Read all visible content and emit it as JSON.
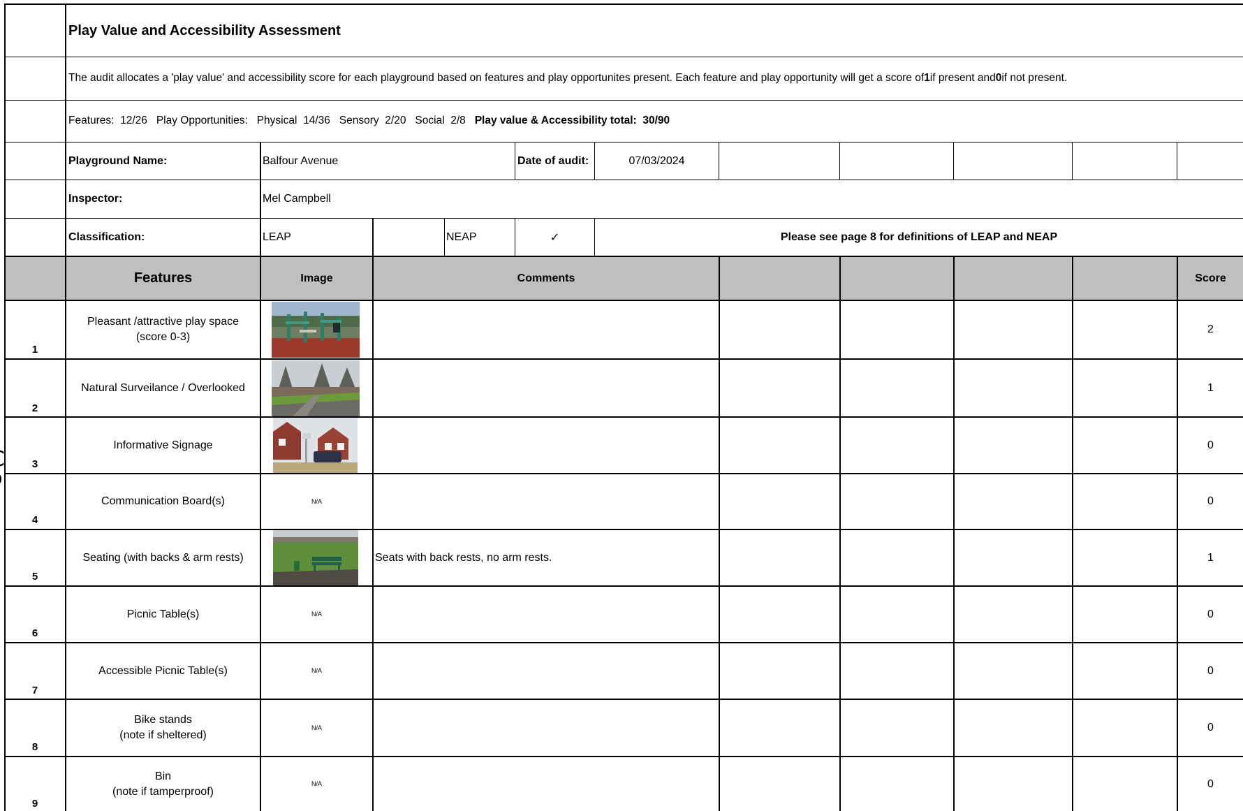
{
  "title": "Play Value and Accessibility Assessment",
  "intro": {
    "before": "The audit  allocates a 'play value' and accessibility score for each playground based on features and play opportunites present.  Each feature and play opportunity will get a score of ",
    "one": "1",
    "middle": " if present and ",
    "zero": "0",
    "after": " if not present."
  },
  "summary": {
    "features_label": "Features:",
    "features_value": "12/26",
    "opportunities_label": "Play Opportunities:",
    "physical_label": "Physical",
    "physical_value": "14/36",
    "sensory_label": "Sensory",
    "sensory_value": "2/20",
    "social_label": "Social",
    "social_value": "2/8",
    "total_label": "Play value & Accessibility total:",
    "total_value": "30/90"
  },
  "info": {
    "playground_label": "Playground Name:",
    "playground_value": "Balfour Avenue",
    "date_label": "Date of audit:",
    "date_value": "07/03/2024",
    "inspector_label": "Inspector:",
    "inspector_value": "Mel Campbell",
    "classification_label": "Classification:",
    "leap_label": "LEAP",
    "neap_label": "NEAP",
    "neap_check": "✓",
    "definitions_note": "Please see page 8 for definitions of LEAP and NEAP"
  },
  "table": {
    "headers": {
      "features": "Features",
      "image": "Image",
      "comments": "Comments",
      "score": "Score"
    },
    "rows": [
      {
        "num": "1",
        "feature_line1": "Pleasant /attractive play space",
        "feature_line2": "(score 0-3)",
        "image": "playground-photo",
        "comment": "",
        "score": "2"
      },
      {
        "num": "2",
        "feature_line1": "Natural Surveilance / Overlooked",
        "feature_line2": "",
        "image": "trees-path-photo",
        "comment": "",
        "score": "1"
      },
      {
        "num": "3",
        "feature_line1": "Informative Signage",
        "feature_line2": "",
        "image": "houses-sign-photo",
        "comment": "",
        "score": "0"
      },
      {
        "num": "4",
        "feature_line1": "Communication Board(s)",
        "feature_line2": "",
        "image": "N/A",
        "comment": "",
        "score": "0"
      },
      {
        "num": "5",
        "feature_line1": "Seating (with backs & arm rests)",
        "feature_line2": "",
        "image": "bench-photo",
        "comment": "Seats with back rests, no arm rests.",
        "score": "1"
      },
      {
        "num": "6",
        "feature_line1": "Picnic Table(s)",
        "feature_line2": "",
        "image": "N/A",
        "comment": "",
        "score": "0"
      },
      {
        "num": "7",
        "feature_line1": "Accessible Picnic Table(s)",
        "feature_line2": "",
        "image": "N/A",
        "comment": "",
        "score": "0"
      },
      {
        "num": "8",
        "feature_line1": "Bike stands",
        "feature_line2": "(note if sheltered)",
        "image": "N/A",
        "comment": "",
        "score": "0"
      },
      {
        "num": "9",
        "feature_line1": "Bin",
        "feature_line2": "(note if tamperproof)",
        "image": "N/A",
        "comment": "",
        "score": "0"
      }
    ]
  },
  "colors": {
    "header_fill": "#bfbfbf",
    "grid": "#000000"
  }
}
